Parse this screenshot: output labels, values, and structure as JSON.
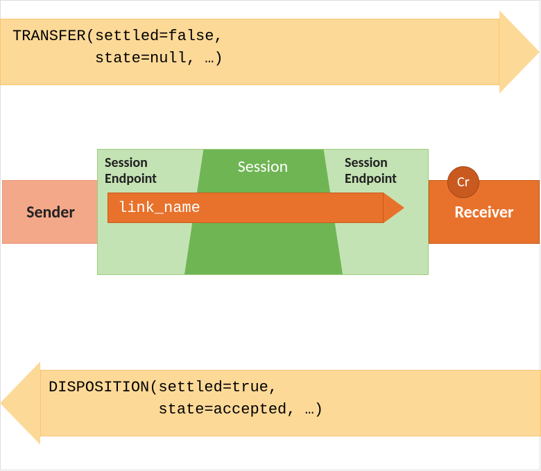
{
  "transfer": {
    "line1": "TRANSFER(settled=false,",
    "line2": "         state=null, …)"
  },
  "disposition": {
    "line1": "DISPOSITION(settled=true,",
    "line2": "            state=accepted, …)"
  },
  "sender": {
    "label": "Sender"
  },
  "receiver": {
    "label": "Receiver"
  },
  "session": {
    "title": "Session",
    "endpoint_left_l1": "Session",
    "endpoint_left_l2": "Endpoint",
    "endpoint_right_l1": "Session",
    "endpoint_right_l2": "Endpoint"
  },
  "link": {
    "name": "link_name"
  },
  "credit": {
    "abbrev": "Cr"
  }
}
